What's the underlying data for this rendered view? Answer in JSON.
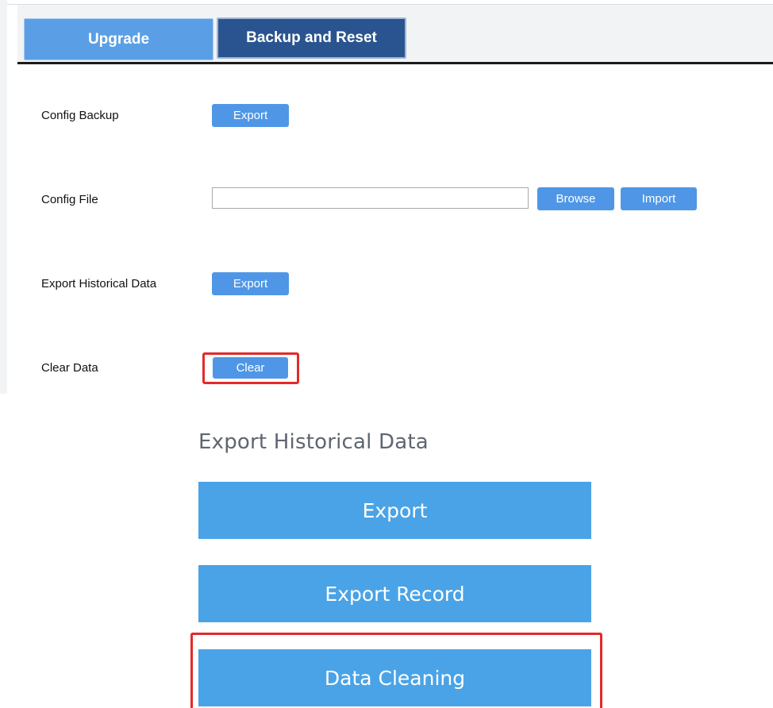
{
  "top": {
    "tabs": [
      {
        "label": "Upgrade",
        "active": false
      },
      {
        "label": "Backup and Reset",
        "active": true
      }
    ],
    "rows": {
      "config_backup": {
        "label": "Config Backup",
        "button": "Export"
      },
      "config_file": {
        "label": "Config File",
        "input_value": "",
        "browse": "Browse",
        "import": "Import"
      },
      "export_historical": {
        "label": "Export Historical Data",
        "button": "Export"
      },
      "clear_data": {
        "label": "Clear Data",
        "button": "Clear"
      }
    }
  },
  "bottom": {
    "title": "Export Historical Data",
    "buttons": {
      "export": "Export",
      "export_record": "Export Record",
      "data_cleaning": "Data Cleaning"
    }
  },
  "colors": {
    "accent": "#4f97e6",
    "tab_active": "#2a548f",
    "highlight": "#e32a2a",
    "mobile_button": "#4aa3e6"
  }
}
